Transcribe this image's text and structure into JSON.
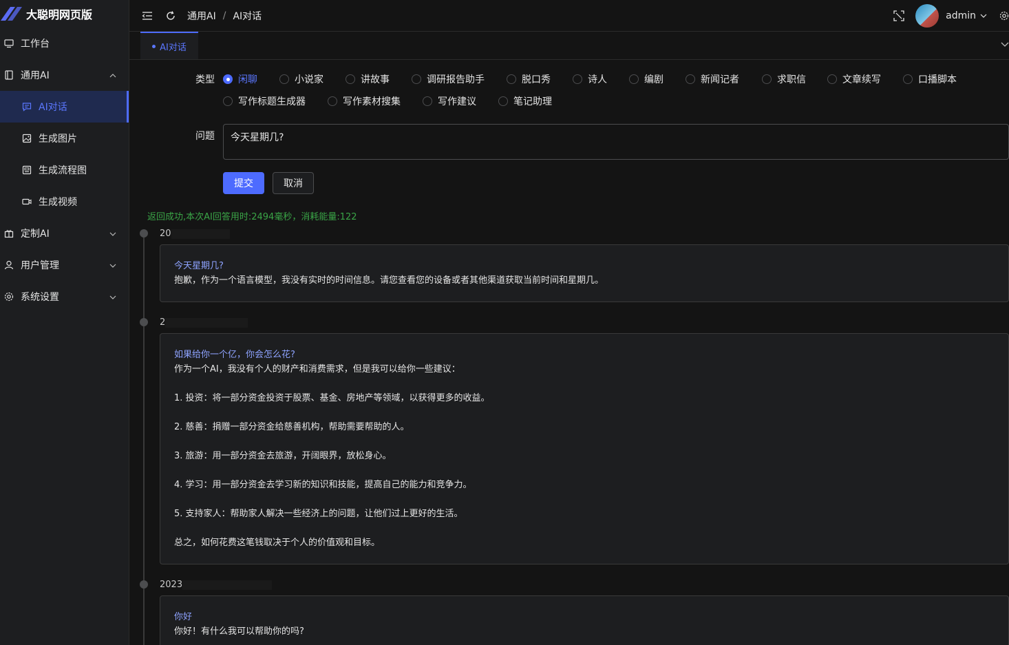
{
  "app": {
    "title": "大聪明网页版"
  },
  "sidebar": {
    "items": [
      {
        "label": "工作台",
        "icon": "monitor-icon"
      },
      {
        "label": "通用AI",
        "icon": "book-icon",
        "expanded": true
      },
      {
        "label": "AI对话",
        "icon": "chat-icon",
        "active": true
      },
      {
        "label": "生成图片",
        "icon": "image-icon"
      },
      {
        "label": "生成流程图",
        "icon": "flowchart-icon"
      },
      {
        "label": "生成视频",
        "icon": "video-icon"
      },
      {
        "label": "定制AI",
        "icon": "gift-icon"
      },
      {
        "label": "用户管理",
        "icon": "user-icon"
      },
      {
        "label": "系统设置",
        "icon": "gear-icon"
      }
    ]
  },
  "header": {
    "breadcrumb": [
      "通用AI",
      "AI对话"
    ],
    "user": "admin"
  },
  "tabs": [
    {
      "label": "AI对话",
      "active": true
    }
  ],
  "form": {
    "type_label": "类型",
    "types": [
      "闲聊",
      "小说家",
      "讲故事",
      "调研报告助手",
      "脱口秀",
      "诗人",
      "编剧",
      "新闻记者",
      "求职信",
      "文章续写",
      "口播脚本",
      "写作标题生成器",
      "写作素材搜集",
      "写作建议",
      "笔记助理"
    ],
    "selected_type": "闲聊",
    "question_label": "问题",
    "question_value": "今天星期几?",
    "submit_label": "提交",
    "cancel_label": "取消"
  },
  "status": "返回成功,本次AI回答用时:2494毫秒，消耗能量:122",
  "timeline": [
    {
      "time_prefix": "20",
      "question": "今天星期几?",
      "answer": "抱歉，作为一个语言模型，我没有实时的时间信息。请您查看您的设备或者其他渠道获取当前时间和星期几。"
    },
    {
      "time_prefix": "2",
      "question": "如果给你一个亿，你会怎么花?",
      "answer": "作为一个AI，我没有个人的财产和消费需求，但是我可以给你一些建议：\n\n1. 投资：将一部分资金投资于股票、基金、房地产等领域，以获得更多的收益。\n\n2. 慈善：捐赠一部分资金给慈善机构，帮助需要帮助的人。\n\n3. 旅游：用一部分资金去旅游，开阔眼界，放松身心。\n\n4. 学习：用一部分资金去学习新的知识和技能，提高自己的能力和竞争力。\n\n5. 支持家人：帮助家人解决一些经济上的问题，让他们过上更好的生活。\n\n总之，如何花费这笔钱取决于个人的价值观和目标。"
    },
    {
      "time_prefix": "2023",
      "question": "你好",
      "answer": "你好！有什么我可以帮助你的吗?"
    }
  ]
}
